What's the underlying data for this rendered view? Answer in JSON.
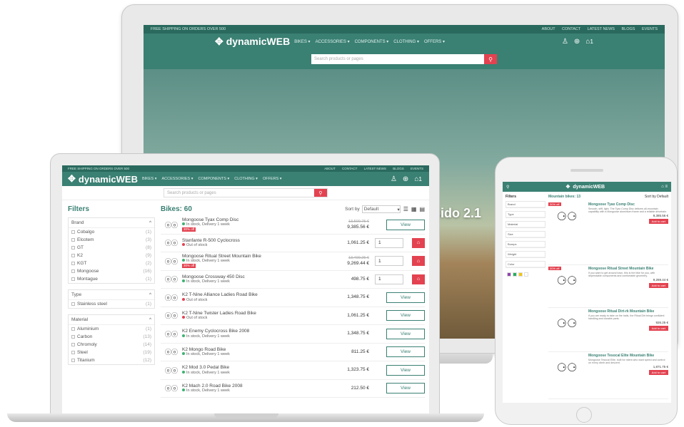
{
  "monitor": {
    "top_notice": "FREE SHIPPING ON ORDERS OVER 500",
    "top_links": [
      "ABOUT",
      "CONTACT",
      "LATEST NEWS",
      "BLOGS",
      "EVENTS"
    ],
    "logo": "dynamicWEB",
    "menu": [
      "BIKES ▾",
      "ACCESSORIES ▾",
      "COMPONENTS ▾",
      "CLOTHING ▾",
      "OFFERS ▾"
    ],
    "search_placeholder": "Search products or pages",
    "cart_count": "1",
    "hero_text": "pido 2.1"
  },
  "laptop": {
    "top_notice": "FREE SHIPPING ON ORDERS OVER 500",
    "top_links": [
      "ABOUT",
      "CONTACT",
      "LATEST NEWS",
      "BLOGS",
      "EVENTS"
    ],
    "logo": "dynamicWEB",
    "menu": [
      "BIKES ▾",
      "ACCESSORIES ▾",
      "COMPONENTS ▾",
      "CLOTHING ▾",
      "OFFERS ▾"
    ],
    "search_placeholder": "Search products or pages",
    "cart_count": "1",
    "filters_title": "Filters",
    "filter_groups": [
      {
        "title": "Brand",
        "items": [
          [
            "Cobalgo",
            "(1)"
          ],
          [
            "Elcotem",
            "(3)"
          ],
          [
            "GT",
            "(8)"
          ],
          [
            "K2",
            "(9)"
          ],
          [
            "KGT",
            "(2)"
          ],
          [
            "Mongoose",
            "(16)"
          ],
          [
            "Montague",
            "(1)"
          ]
        ]
      },
      {
        "title": "Type",
        "items": [
          [
            "Stainless steel",
            "(1)"
          ]
        ]
      },
      {
        "title": "Material",
        "items": [
          [
            "Aluminium",
            "(1)"
          ],
          [
            "Carbon",
            "(13)"
          ],
          [
            "Chromoly",
            "(14)"
          ],
          [
            "Steel",
            "(19)"
          ],
          [
            "Titanium",
            "(12)"
          ]
        ]
      }
    ],
    "list_title": "Bikes: 60",
    "sort_label": "Sort by",
    "sort_value": "Default",
    "view_label": "View",
    "products": [
      {
        "name": "Mongoose Tyax Comp Disc",
        "stock": "In stock, Delivery 1 week",
        "badge": "30% off",
        "old": "13,500.75 €",
        "price": "9,385.56 €",
        "status": "in",
        "action": "view"
      },
      {
        "name": "Stanfante R-500 Cyclocross",
        "stock": "Out of stock",
        "badge": "",
        "old": "",
        "price": "1,061.25 €",
        "status": "out",
        "action": "cart"
      },
      {
        "name": "Mongoose Ritual Street Mountain Bike",
        "stock": "In stock, Delivery 1 week",
        "badge": "30% off",
        "old": "13,499.25 €",
        "price": "9,269.44 €",
        "status": "in",
        "action": "cart"
      },
      {
        "name": "Mongoose Crossway 450 Disc",
        "stock": "In stock, Delivery 1 week",
        "badge": "",
        "old": "",
        "price": "498.75 €",
        "status": "in",
        "action": "cart"
      },
      {
        "name": "K2 T-Nine Alliance Ladies Road Bike",
        "stock": "Out of stock",
        "badge": "",
        "old": "",
        "price": "1,348.75 €",
        "status": "out",
        "action": "view"
      },
      {
        "name": "K2 T-Nine Twister Ladies Road Bike",
        "stock": "Out of stock",
        "badge": "",
        "old": "",
        "price": "1,061.25 €",
        "status": "out",
        "action": "view"
      },
      {
        "name": "K2 Enemy Cyclocross Bike 2008",
        "stock": "In stock, Delivery 1 week",
        "badge": "",
        "old": "",
        "price": "1,348.75 €",
        "status": "in",
        "action": "view"
      },
      {
        "name": "K2 Mongo Road Bike",
        "stock": "In stock, Delivery 1 week",
        "badge": "",
        "old": "",
        "price": "811.25 €",
        "status": "in",
        "action": "view"
      },
      {
        "name": "K2 Mod 3.0 Pedal Bike",
        "stock": "In stock, Delivery 1 week",
        "badge": "",
        "old": "",
        "price": "1,323.75 €",
        "status": "in",
        "action": "view"
      },
      {
        "name": "K2 Mach 2.0 Road Bike 2008",
        "stock": "In stock, Delivery 1 week",
        "badge": "",
        "old": "",
        "price": "212.50 €",
        "status": "in",
        "action": "view"
      }
    ],
    "qty_value": "1"
  },
  "phone": {
    "logo": "dynamicWEB",
    "filters_title": "Filters",
    "filter_groups": [
      "Brand",
      "Type",
      "Material",
      "Size",
      "Bumps",
      "Weight",
      "Color"
    ],
    "list_title": "Mountain bikes: 13",
    "sort": "Sort by  Default",
    "swatches": [
      "#8e44ad",
      "#27ae60",
      "#f1c40f",
      "#ffffff"
    ],
    "products": [
      {
        "name": "Mongoose Tyax Comp Disc",
        "badge": "30% off",
        "price": "9,385.56 €",
        "desc": "Smooth, stiff, light. The Tyax Comp Disc delivers all-mountain capability with a Mongoose aluminium frame and a reliable drivetrain."
      },
      {
        "name": "Mongoose Ritual Street Mountain Bike",
        "badge": "30% off",
        "price": "9,269.44 €",
        "desc": "If you want to get around town, this is the bike for you, with dependable components and comfortable geometry."
      },
      {
        "name": "Mongoose Ritual Dirt-rk Mountain Bike",
        "badge": "",
        "price": "926.25 €",
        "desc": "If you are ready to take on the trails, the Ritual Dirt brings confident handling and durable parts."
      },
      {
        "name": "Mongoose Tesocal Elite Mountain Bike",
        "badge": "",
        "price": "1,871.75 €",
        "desc": "Mongoose Tesocal Elite, built for riders who want speed and control on every climb and descent."
      }
    ],
    "cart_label": "Add to cart"
  }
}
